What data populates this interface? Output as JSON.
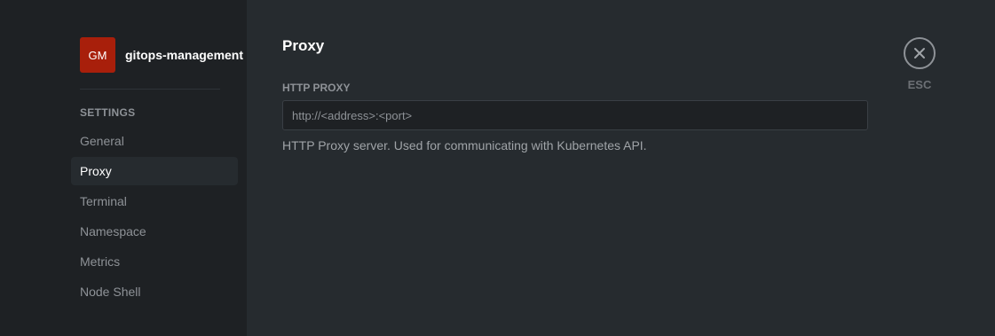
{
  "cluster": {
    "avatar_initials": "GM",
    "avatar_color": "#a81f0b",
    "name": "gitops-management"
  },
  "sidebar": {
    "section_title": "SETTINGS",
    "items": [
      {
        "label": "General",
        "active": false
      },
      {
        "label": "Proxy",
        "active": true
      },
      {
        "label": "Terminal",
        "active": false
      },
      {
        "label": "Namespace",
        "active": false
      },
      {
        "label": "Metrics",
        "active": false
      },
      {
        "label": "Node Shell",
        "active": false
      }
    ]
  },
  "main": {
    "title": "Proxy",
    "http_proxy": {
      "label": "HTTP PROXY",
      "value": "",
      "placeholder": "http://<address>:<port>",
      "help": "HTTP Proxy server. Used for communicating with Kubernetes API."
    }
  },
  "close": {
    "icon": "close-icon",
    "label": "ESC"
  }
}
